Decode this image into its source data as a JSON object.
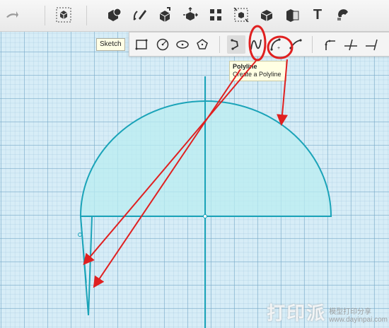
{
  "toolbar": {
    "items": [
      {
        "name": "redo-arrow-icon"
      },
      {
        "name": "grid-cube-icon"
      },
      {
        "name": "primitive-shapes-icon"
      },
      {
        "name": "sketch-pencil-icon"
      },
      {
        "name": "construct-cube-icon"
      },
      {
        "name": "transform-cube-icon"
      },
      {
        "name": "pattern-grid-icon"
      },
      {
        "name": "group-icon"
      },
      {
        "name": "modify-cube-icon"
      },
      {
        "name": "combine-icon"
      },
      {
        "name": "text-icon"
      },
      {
        "name": "snap-magnet-icon"
      }
    ],
    "text_tool_glyph": "T"
  },
  "sketch_label": "Sketch",
  "sketch_tools": [
    {
      "name": "rectangle-tool-icon"
    },
    {
      "name": "circle-tool-icon"
    },
    {
      "name": "ellipse-tool-icon"
    },
    {
      "name": "polygon-tool-icon"
    },
    {
      "name": "polyline-tool-icon"
    },
    {
      "name": "spline-tool-icon"
    },
    {
      "name": "two-point-arc-tool-icon"
    },
    {
      "name": "three-point-arc-tool-icon"
    },
    {
      "name": "fillet-tool-icon"
    },
    {
      "name": "trim-tool-icon"
    },
    {
      "name": "extend-tool-icon"
    }
  ],
  "tooltip": {
    "title": "Polyline",
    "description": "Create a Polyline"
  },
  "colors": {
    "shape_fill": "#b9ecf0",
    "shape_stroke": "#1aa3b8",
    "annotation_red": "#e02020",
    "grid_background": "#d7edf7"
  },
  "watermark": {
    "big": "打印派",
    "zh": "模型打印分享",
    "url": "www.dayinpai.com"
  }
}
